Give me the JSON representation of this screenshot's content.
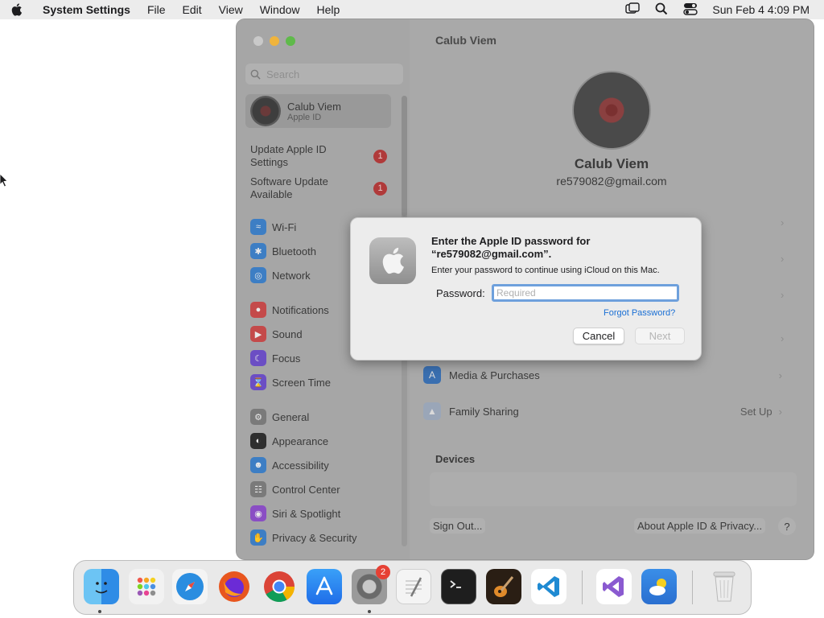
{
  "menubar": {
    "app_name": "System Settings",
    "menus": [
      "File",
      "Edit",
      "View",
      "Window",
      "Help"
    ],
    "clock": "Sun Feb 4  4:09 PM"
  },
  "window": {
    "title": "Calub Viem",
    "search_placeholder": "Search",
    "account": {
      "name": "Calub Viem",
      "subtitle": "Apple ID"
    },
    "alerts": [
      {
        "label": "Update Apple ID Settings",
        "badge": "1"
      },
      {
        "label": "Software Update Available",
        "badge": "1"
      }
    ],
    "sidebar_items": [
      {
        "label": "Wi-Fi",
        "icon": "wifi-icon",
        "color": "#3d7ec4"
      },
      {
        "label": "Bluetooth",
        "icon": "bluetooth-icon",
        "color": "#3d7ec4"
      },
      {
        "label": "Network",
        "icon": "globe-icon",
        "color": "#3d7ec4"
      },
      {
        "label": "Notifications",
        "icon": "bell-icon",
        "color": "#c44a4a"
      },
      {
        "label": "Sound",
        "icon": "speaker-icon",
        "color": "#c44a4a"
      },
      {
        "label": "Focus",
        "icon": "moon-icon",
        "color": "#6b4ec4"
      },
      {
        "label": "Screen Time",
        "icon": "hourglass-icon",
        "color": "#6b4ec4"
      },
      {
        "label": "General",
        "icon": "gear-icon",
        "color": "#7a7a7a"
      },
      {
        "label": "Appearance",
        "icon": "appearance-icon",
        "color": "#2f2f2f"
      },
      {
        "label": "Accessibility",
        "icon": "accessibility-icon",
        "color": "#3d7ec4"
      },
      {
        "label": "Control Center",
        "icon": "control-center-icon",
        "color": "#7a7a7a"
      },
      {
        "label": "Siri & Spotlight",
        "icon": "siri-icon",
        "color": "#8a4ec4"
      },
      {
        "label": "Privacy & Security",
        "icon": "hand-icon",
        "color": "#3d7ec4"
      }
    ],
    "profile": {
      "name": "Calub Viem",
      "email": "re579082@gmail.com"
    },
    "rows": [
      {
        "label": "Media & Purchases",
        "icon": "app-store-icon",
        "trail": ""
      },
      {
        "label": "Family Sharing",
        "icon": "family-icon",
        "trail": "Set Up"
      }
    ],
    "devices_label": "Devices",
    "sign_out": "Sign Out...",
    "about": "About Apple ID & Privacy...",
    "help": "?"
  },
  "dialog": {
    "title": "Enter the Apple ID password for “re579082@gmail.com”.",
    "message": "Enter your password to continue using iCloud on this Mac.",
    "password_label": "Password:",
    "password_placeholder": "Required",
    "forgot": "Forgot Password?",
    "cancel": "Cancel",
    "next": "Next"
  },
  "dock": {
    "apps": [
      {
        "name": "finder-icon",
        "color": "#2f8ce6"
      },
      {
        "name": "launchpad-icon",
        "color": "#f2f2f2"
      },
      {
        "name": "safari-icon",
        "color": "#2a8de0"
      },
      {
        "name": "firefox-icon",
        "color": "#e8561e"
      },
      {
        "name": "chrome-icon",
        "color": "#f4f4f4"
      },
      {
        "name": "app-store-icon",
        "color": "#2f7ff0"
      },
      {
        "name": "system-settings-icon",
        "color": "#8a8a8a"
      },
      {
        "name": "textedit-icon",
        "color": "#f4f4f4"
      },
      {
        "name": "terminal-icon",
        "color": "#1e1e1e"
      },
      {
        "name": "garageband-icon",
        "color": "#3a2a1a"
      },
      {
        "name": "vscode-icon",
        "color": "#ffffff"
      },
      {
        "name": "visual-studio-icon",
        "color": "#ffffff"
      },
      {
        "name": "weather-icon",
        "color": "#3a8ee8"
      },
      {
        "name": "trash-icon",
        "color": "#e9e9e9"
      }
    ],
    "settings_badge": "2"
  }
}
